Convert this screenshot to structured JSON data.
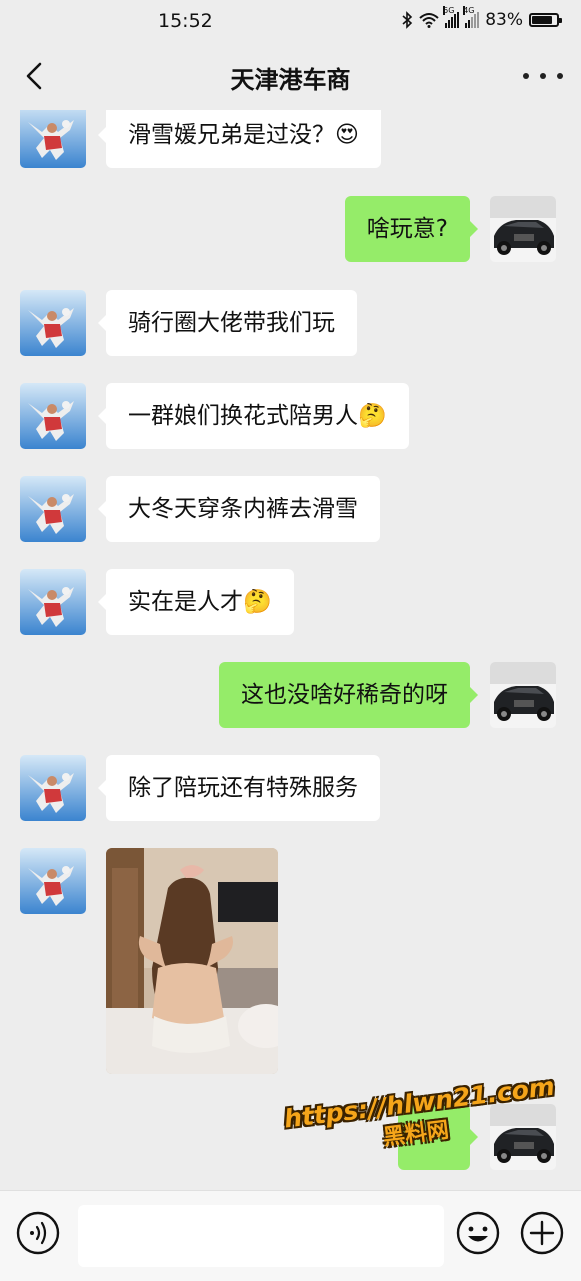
{
  "status": {
    "time": "15:52",
    "network_1": "5G",
    "network_2": "4G",
    "battery_text": "83%",
    "battery_level": 0.83
  },
  "nav": {
    "title": "天津港车商"
  },
  "messages": [
    {
      "side": "in",
      "text": "滑雪媛兄弟是过没？😍"
    },
    {
      "side": "out",
      "text": "啥玩意?"
    },
    {
      "side": "in",
      "text": "骑行圈大佬带我们玩"
    },
    {
      "side": "in",
      "text": "一群娘们换花式陪男人🤔"
    },
    {
      "side": "in",
      "text": "大冬天穿条内裤去滑雪"
    },
    {
      "side": "in",
      "text": "实在是人才🤔"
    },
    {
      "side": "out",
      "text": "这也没啥好稀奇的呀"
    },
    {
      "side": "in",
      "text": "除了陪玩还有特殊服务"
    },
    {
      "side": "in",
      "type": "image"
    },
    {
      "side": "out",
      "text": ""
    }
  ],
  "watermark": {
    "url": "https://hlwn21.com",
    "name": "黑料网"
  },
  "icons": {
    "back": "chevron-left-icon",
    "more": "more-dots-icon",
    "voice": "voice-icon",
    "emoji": "emoji-icon",
    "plus": "plus-icon"
  }
}
